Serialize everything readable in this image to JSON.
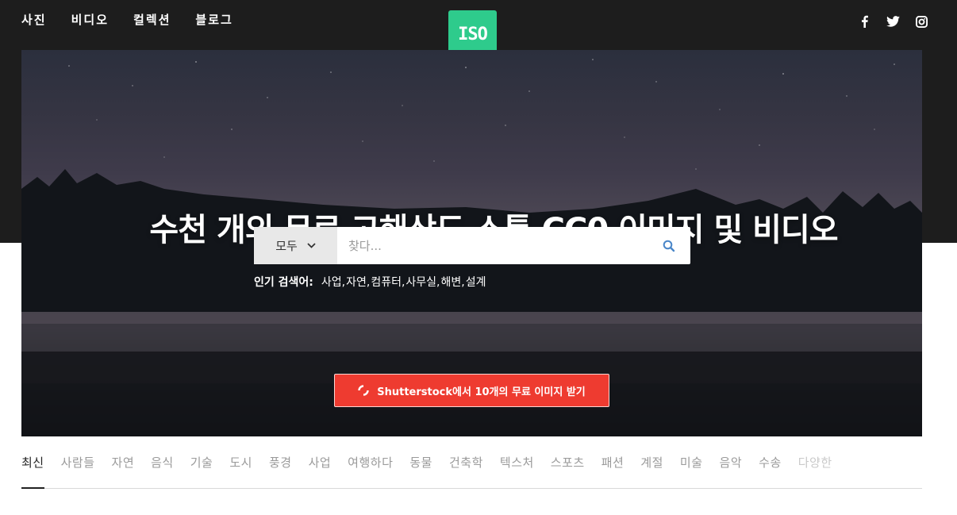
{
  "nav": {
    "items": [
      "사진",
      "비디오",
      "컬렉션",
      "블로그"
    ]
  },
  "logo": {
    "text": "ISO",
    "color": "#2ecb8c"
  },
  "social": {
    "icons": [
      "facebook-icon",
      "twitter-icon",
      "instagram-icon"
    ]
  },
  "hero": {
    "headline": "수천 개의 무료 고해상도 스톡 CC0 이미지 및 비디오",
    "search": {
      "category": "모두",
      "placeholder": "찾다..."
    },
    "popular": {
      "label": "인기 검색어:",
      "terms": [
        "사업",
        "자연",
        "컴퓨터",
        "사무실",
        "해변",
        "설계"
      ]
    },
    "promo": {
      "label": "Shutterstock에서 10개의 무료 이미지 받기",
      "color": "#ee3b30"
    }
  },
  "categories": {
    "active": "최신",
    "items": [
      "최신",
      "사람들",
      "자연",
      "음식",
      "기술",
      "도시",
      "풍경",
      "사업",
      "여행하다",
      "동물",
      "건축학",
      "텍스처",
      "스포츠",
      "패션",
      "계절",
      "미술",
      "음악",
      "수송",
      "다양한"
    ]
  }
}
